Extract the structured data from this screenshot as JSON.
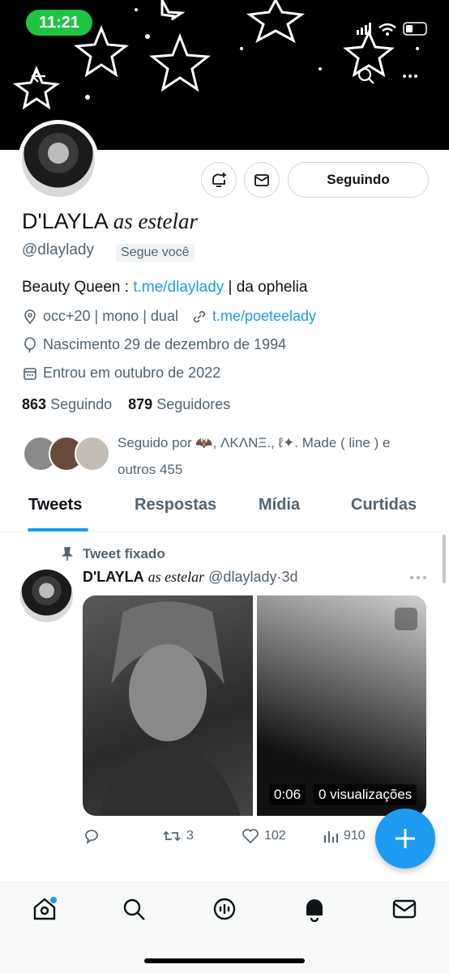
{
  "status_bar": {
    "time": "11:21"
  },
  "profile": {
    "display_name": "D'LAYLA",
    "display_name_italic": "as estelar",
    "handle": "@dlaylady",
    "follows_you": "Segue você",
    "following_button": "Seguindo",
    "bio_prefix": "Beauty Queen : ",
    "bio_link": "t.me/dlaylady",
    "bio_suffix": " | da ophelia",
    "location": "occ+20 | mono | dual",
    "website": "t.me/poeteelady",
    "birthday": "Nascimento 29 de dezembro de 1994",
    "joined": "Entrou em outubro de 2022",
    "following_count": "863",
    "following_label": "Seguindo",
    "followers_count": "879",
    "followers_label": "Seguidores",
    "followed_by_line1": "Seguido por 🦇, ΛKΛNΞ., ℓ✦. Made ( line ) e",
    "followed_by_line2": "outros 455"
  },
  "tabs": [
    "Tweets",
    "Respostas",
    "Mídia",
    "Curtidas"
  ],
  "tweet": {
    "pinned_label": "Tweet fixado",
    "name": "D'LAYLA",
    "name_italic": "as estelar",
    "handle": "@dlaylady",
    "separator": "·",
    "time": "3d",
    "video_duration": "0:06",
    "video_views": "0 visualizações",
    "retweets": "3",
    "likes": "102",
    "views": "910"
  },
  "icons": {
    "back": "arrow-left-icon",
    "search": "search-icon",
    "more": "more-icon",
    "notify": "bell-plus-icon",
    "message": "mail-icon",
    "location": "pin-icon",
    "link": "link-icon",
    "birthday": "balloon-icon",
    "calendar": "calendar-icon",
    "pin": "pin-tack-icon",
    "reply": "reply-icon",
    "retweet": "retweet-icon",
    "like": "heart-icon",
    "views": "views-icon",
    "compose": "plus-icon"
  },
  "colors": {
    "accent": "#1d9bf0",
    "status_green": "#1fc542"
  }
}
